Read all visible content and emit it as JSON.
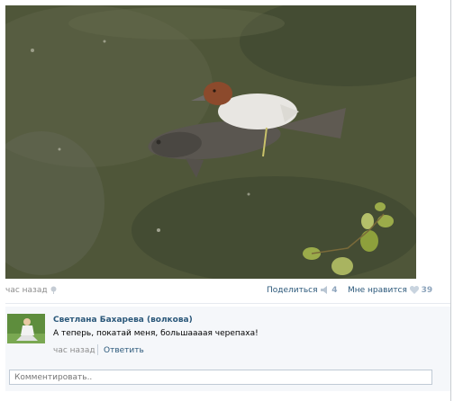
{
  "post": {
    "photo_icon": "post-photo-duck-on-fish",
    "time": "час назад",
    "share_label": "Поделиться",
    "share_count": "4",
    "like_label": "Мне нравится",
    "like_count": "39"
  },
  "comment": {
    "author": "Светлана Бахарева (волкова)",
    "text": "А теперь, покатай меня, большаааая черепаха!",
    "time": "час назад",
    "reply_label": "Ответить"
  },
  "compose": {
    "placeholder": "Комментировать.."
  },
  "colors": {
    "link": "#2b587a",
    "muted": "#8c8c8c",
    "count": "#8da4bc"
  }
}
